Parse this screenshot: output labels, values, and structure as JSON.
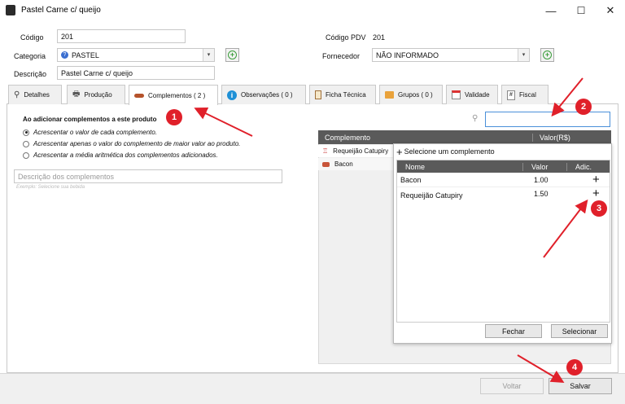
{
  "window": {
    "title": "Pastel Carne c/ queijo",
    "min": "—",
    "max": "☐",
    "close": "✕"
  },
  "form": {
    "codigo_label": "Código",
    "codigo_value": "201",
    "codigo_pdv_label": "Código PDV",
    "codigo_pdv_value": "201",
    "categoria_label": "Categoria",
    "categoria_value": "PASTEL",
    "fornecedor_label": "Fornecedor",
    "fornecedor_value": "NÃO INFORMADO",
    "descricao_label": "Descrição",
    "descricao_value": "Pastel Carne c/ queijo"
  },
  "tabs": [
    {
      "label": "Detalhes"
    },
    {
      "label": "Produção"
    },
    {
      "label": "Complementos ( 2 )"
    },
    {
      "label": "Observações ( 0 )"
    },
    {
      "label": "Ficha Técnica"
    },
    {
      "label": "Grupos ( 0 )"
    },
    {
      "label": "Validade"
    },
    {
      "label": "Fiscal"
    }
  ],
  "complementos": {
    "heading": "Ao adicionar complementos a este produto",
    "options": [
      "Acrescentar o valor de cada complemento.",
      "Acrescentar apenas o valor do complemento de maior valor ao produto.",
      "Acrescentar a média aritmética dos complementos adicionados."
    ],
    "desc_placeholder": "Descrição dos complementos",
    "desc_example": "Exemplo: Selecione sua bebida",
    "grid_headers": {
      "complemento": "Complemento",
      "valor": "Valor(R$)"
    },
    "rows": [
      {
        "name": "Requeijão Catupiry"
      },
      {
        "name": "Bacon"
      }
    ]
  },
  "popup": {
    "title": "Selecione um complemento",
    "headers": {
      "nome": "Nome",
      "valor": "Valor",
      "adic": "Adic."
    },
    "rows": [
      {
        "nome": "Bacon",
        "valor": "1.00"
      },
      {
        "nome": "Requeijão Catupiry",
        "valor": "1.50"
      }
    ],
    "fechar": "Fechar",
    "selecionar": "Selecionar"
  },
  "footer": {
    "voltar": "Voltar",
    "salvar": "Salvar"
  },
  "annotations": [
    "1",
    "2",
    "3",
    "4"
  ],
  "colors": {
    "arrow": "#e0202a",
    "grid_header": "#5a5a5a",
    "add_green": "#3a9d3a"
  }
}
